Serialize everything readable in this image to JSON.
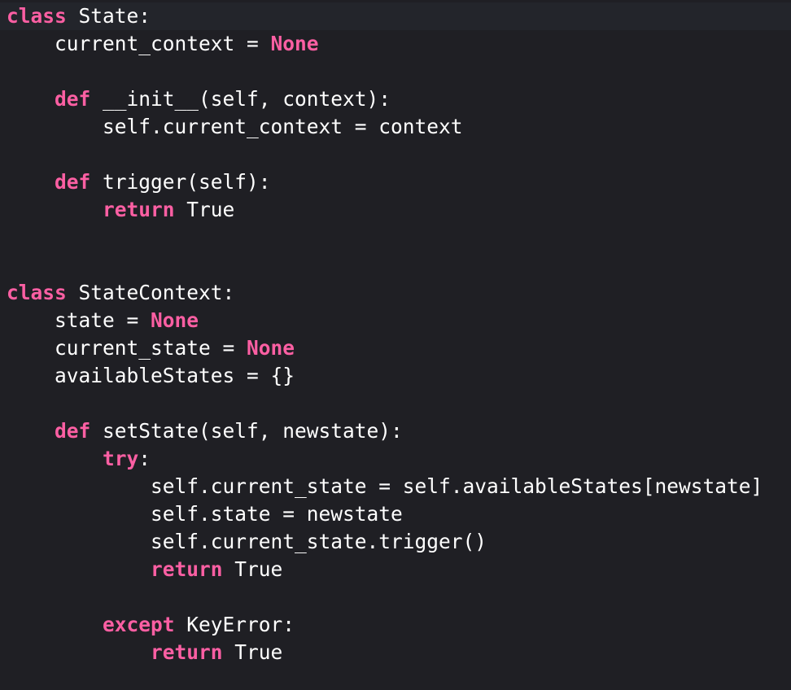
{
  "editor": {
    "theme": {
      "background": "#1f1f24",
      "current_line": "#23252b",
      "keyword_color": "#fc5fa3",
      "text_color": "#ffffff"
    },
    "lines": [
      [
        {
          "t": "class",
          "k": true
        },
        {
          "t": " State:"
        }
      ],
      [
        {
          "t": "    current_context = "
        },
        {
          "t": "None",
          "k": true
        }
      ],
      [],
      [
        {
          "t": "    "
        },
        {
          "t": "def",
          "k": true
        },
        {
          "t": " __init__(self, context):"
        }
      ],
      [
        {
          "t": "        self.current_context = context"
        }
      ],
      [],
      [
        {
          "t": "    "
        },
        {
          "t": "def",
          "k": true
        },
        {
          "t": " trigger(self):"
        }
      ],
      [
        {
          "t": "        "
        },
        {
          "t": "return",
          "k": true
        },
        {
          "t": " True"
        }
      ],
      [],
      [],
      [
        {
          "t": "class",
          "k": true
        },
        {
          "t": " StateContext:"
        }
      ],
      [
        {
          "t": "    state = "
        },
        {
          "t": "None",
          "k": true
        }
      ],
      [
        {
          "t": "    current_state = "
        },
        {
          "t": "None",
          "k": true
        }
      ],
      [
        {
          "t": "    availableStates = {}"
        }
      ],
      [],
      [
        {
          "t": "    "
        },
        {
          "t": "def",
          "k": true
        },
        {
          "t": " setState(self, newstate):"
        }
      ],
      [
        {
          "t": "        "
        },
        {
          "t": "try",
          "k": true
        },
        {
          "t": ":"
        }
      ],
      [
        {
          "t": "            self.current_state = self.availableStates[newstate]"
        }
      ],
      [
        {
          "t": "            self.state = newstate"
        }
      ],
      [
        {
          "t": "            self.current_state.trigger()"
        }
      ],
      [
        {
          "t": "            "
        },
        {
          "t": "return",
          "k": true
        },
        {
          "t": " True"
        }
      ],
      [],
      [
        {
          "t": "        "
        },
        {
          "t": "except",
          "k": true
        },
        {
          "t": " KeyError:"
        }
      ],
      [
        {
          "t": "            "
        },
        {
          "t": "return",
          "k": true
        },
        {
          "t": " True"
        }
      ]
    ]
  }
}
